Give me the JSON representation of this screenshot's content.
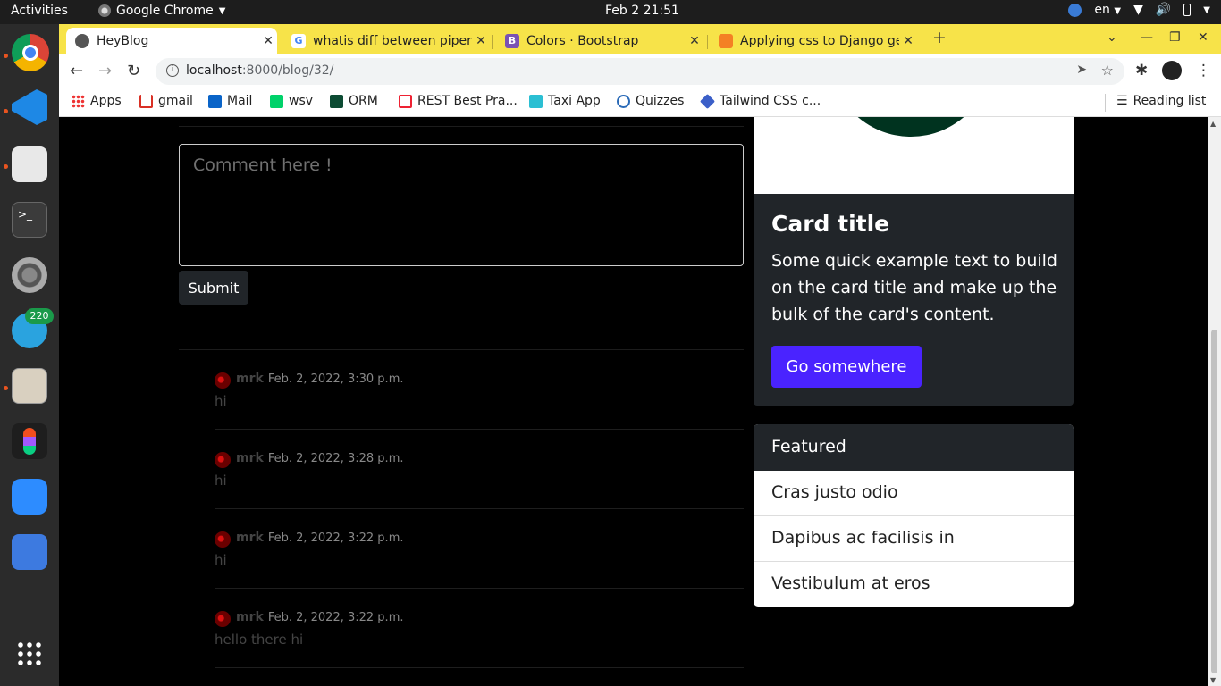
{
  "system": {
    "activities_label": "Activities",
    "app_name": "Google Chrome",
    "clock": "Feb 2  21:51",
    "language": "en",
    "telegram_badge": "220"
  },
  "browser": {
    "tabs": [
      {
        "title": "HeyBlog",
        "active": true
      },
      {
        "title": "whatis diff between piper",
        "active": false
      },
      {
        "title": "Colors · Bootstrap",
        "active": false
      },
      {
        "title": "Applying css to Django ge",
        "active": false
      }
    ],
    "url_host": "localhost",
    "url_path": ":8000/blog/32/",
    "bookmarks": [
      "Apps",
      "gmail",
      "Mail",
      "wsv",
      "ORM",
      "REST Best Pra...",
      "Taxi App",
      "Quizzes",
      "Tailwind CSS c..."
    ],
    "reading_list": "Reading list"
  },
  "page": {
    "comment_placeholder": "Comment here !",
    "submit_label": "Submit",
    "comments": [
      {
        "user": "mrk",
        "date": "Feb. 2, 2022, 3:30 p.m.",
        "text": "hi"
      },
      {
        "user": "mrk",
        "date": "Feb. 2, 2022, 3:28 p.m.",
        "text": "hi"
      },
      {
        "user": "mrk",
        "date": "Feb. 2, 2022, 3:22 p.m.",
        "text": "hi"
      },
      {
        "user": "mrk",
        "date": "Feb. 2, 2022, 3:22 p.m.",
        "text": "hello there hi"
      }
    ],
    "card": {
      "title": "Card title",
      "text": "Some quick example text to build on the card title and make up the bulk of the card's content.",
      "button": "Go somewhere"
    },
    "featured": {
      "header": "Featured",
      "items": [
        "Cras justo odio",
        "Dapibus ac facilisis in",
        "Vestibulum at eros"
      ]
    }
  },
  "colors": {
    "tabstrip": "#f7e349",
    "primary_button": "#4a23ff",
    "card_dark": "#212529"
  }
}
